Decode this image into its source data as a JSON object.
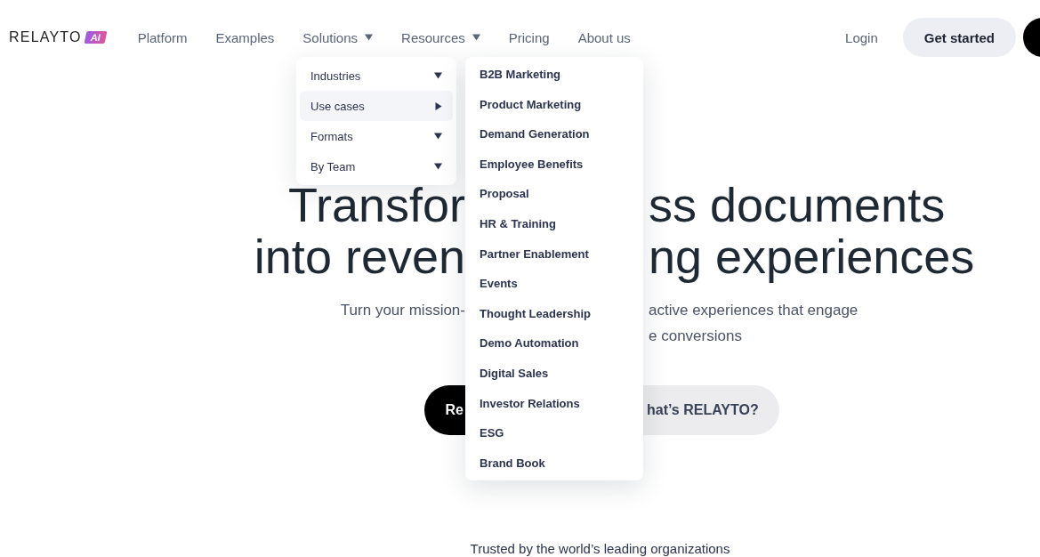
{
  "header": {
    "logo": {
      "wordmark": "RELAYTO",
      "badge": "AI"
    },
    "nav": [
      {
        "label": "Platform",
        "dropdown": false
      },
      {
        "label": "Examples",
        "dropdown": false
      },
      {
        "label": "Solutions",
        "dropdown": true
      },
      {
        "label": "Resources",
        "dropdown": true
      },
      {
        "label": "Pricing",
        "dropdown": false
      },
      {
        "label": "About us",
        "dropdown": false
      }
    ],
    "login": "Login",
    "cta": "Get started"
  },
  "solutions_menu": [
    {
      "label": "Industries",
      "selected": false
    },
    {
      "label": "Use cases",
      "selected": true
    },
    {
      "label": "Formats",
      "selected": false
    },
    {
      "label": "By Team",
      "selected": false
    }
  ],
  "use_cases_menu": [
    "B2B Marketing",
    "Product Marketing",
    "Demand Generation",
    "Employee Benefits",
    "Proposal",
    "HR & Training",
    "Partner Enablement",
    "Events",
    "Thought Leadership",
    "Demo Automation",
    "Digital Sales",
    "Investor Relations",
    "ESG",
    "Brand Book"
  ],
  "hero": {
    "headline": [
      [
        "Transfor",
        "ss documents"
      ],
      [
        "into reven",
        "ng experiences"
      ]
    ],
    "subtitle": [
      {
        "left": "Turn your mission-",
        "right": "active experiences that engage"
      },
      {
        "right": "e conversions"
      }
    ],
    "buttons": [
      "Re",
      "hat’s RELAYTO?"
    ],
    "trusted": "Trusted by the world’s leading organizations"
  }
}
